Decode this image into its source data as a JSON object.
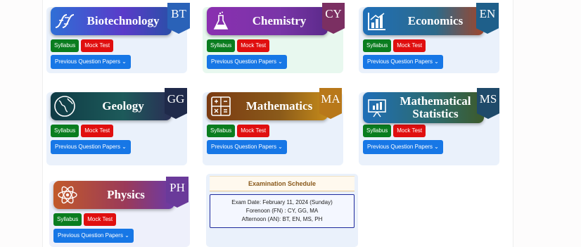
{
  "subjects": [
    {
      "name": "Biotechnology",
      "code": "BT",
      "icon": "dna-icon",
      "syllabus": "Syllabus",
      "mock": "Mock Test",
      "papers": "Previous Question Papers"
    },
    {
      "name": "Chemistry",
      "code": "CY",
      "icon": "flask-icon",
      "syllabus": "Syllabus",
      "mock": "Mock Test",
      "papers": "Previous Question Papers"
    },
    {
      "name": "Economics",
      "code": "EN",
      "icon": "bar-chart-icon",
      "syllabus": "Syllabus",
      "mock": "Mock Test",
      "papers": "Previous Question Papers"
    },
    {
      "name": "Geology",
      "code": "GG",
      "icon": "globe-icon",
      "syllabus": "Syllabus",
      "mock": "Mock Test",
      "papers": "Previous Question Papers"
    },
    {
      "name": "Mathematics",
      "code": "MA",
      "icon": "calculator-icon",
      "syllabus": "Syllabus",
      "mock": "Mock Test",
      "papers": "Previous Question Papers"
    },
    {
      "name_line1": "Mathematical",
      "name_line2": "Statistics",
      "code": "MS",
      "icon": "presentation-chart-icon",
      "syllabus": "Syllabus",
      "mock": "Mock Test",
      "papers": "Previous Question Papers"
    },
    {
      "name": "Physics",
      "code": "PH",
      "icon": "atom-icon",
      "syllabus": "Syllabus",
      "mock": "Mock Test",
      "papers": "Previous Question Papers"
    }
  ],
  "schedule": {
    "title": "Examination Schedule",
    "date": "Exam Date: February 11, 2024 (Sunday)",
    "forenoon": "Forenoon (FN) : CY, GG, MA",
    "afternoon": "Afternoon (AN): BT, EN, MS, PH"
  },
  "colors": {
    "syllabus_button": "#0a7d1f",
    "mock_button": "#e00f0f",
    "papers_button": "#1777e6"
  }
}
